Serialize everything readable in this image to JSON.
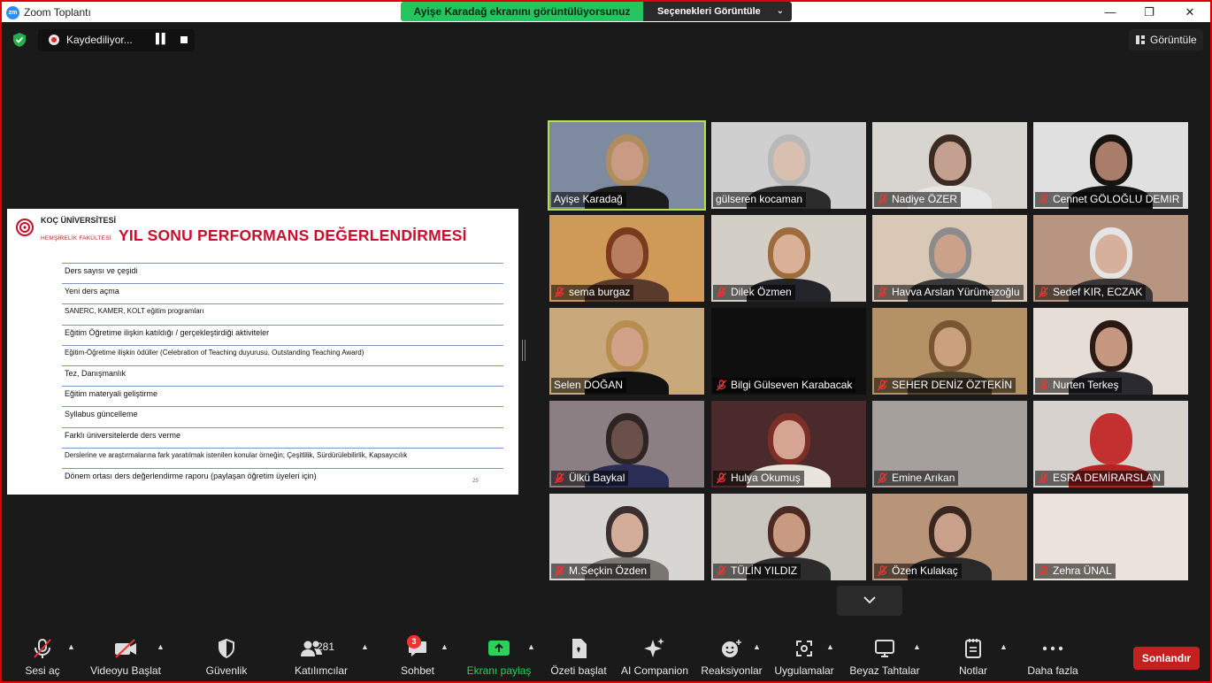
{
  "window": {
    "title": "Zoom Toplantı",
    "logo_text": "zm",
    "minimize": "—",
    "maximize": "❐",
    "close": "✕"
  },
  "share_banner": {
    "text": "Ayişe Karadağ ekranını görüntülüyorsunuz",
    "options_label": "Seçenekleri Görüntüle"
  },
  "recording": {
    "label": "Kaydediliyor..."
  },
  "view_button": {
    "label": "Görüntüle"
  },
  "slide": {
    "university": "KOÇ ÜNİVERSİTESİ",
    "faculty": "HEMŞİRELİK FAKÜLTESİ",
    "title": "YIL SONU PERFORMANS DEĞERLENDİRMESİ",
    "rows": [
      "Ders sayısı ve çeşidi",
      "Yeni ders açma",
      "SANERC, KAMER, KOLT eğitim programları",
      "Eğitim Öğretime ilişkin katıldığı / gerçekleştirdiği aktiviteler",
      "Eğitim-Öğretime ilişkin ödüller (Celebration of Teaching duyurusu, Outstanding Teaching Award)",
      "Tez, Danışmanlık",
      "Eğitim materyali geliştirme",
      "Syllabus güncelleme",
      "Farklı üniversitelerde ders verme",
      "Derslerine ve araştırmalarına fark yaratılmak istenilen konular örneğin; Çeşitlilik, Sürdürülebilirlik, Kapsayıcılık",
      "Dönem ortası ders değerlendirme raporu (paylaşan öğretim üyeleri için)"
    ],
    "page_number": "25"
  },
  "participants": [
    {
      "name": "Ayişe Karadağ",
      "muted": false,
      "active": true,
      "bg": "#7d8aa0",
      "skin": "#c99a84",
      "hair": "#b08d5c",
      "shirt": "#1c1c1c"
    },
    {
      "name": "gülseren kocaman",
      "muted": false,
      "active": false,
      "bg": "#cfcfcf",
      "skin": "#d9bfb0",
      "hair": "#b8b8b8",
      "shirt": "#2c2c2c"
    },
    {
      "name": "Nadiye ÖZER",
      "muted": true,
      "active": false,
      "bg": "#d8d4cf",
      "skin": "#c4a091",
      "hair": "#3b2b22",
      "shirt": "#e6e6e6"
    },
    {
      "name": "Cennet GÖLOĞLU DEMIR",
      "muted": true,
      "active": false,
      "bg": "#e0e0e0",
      "skin": "#a97d6a",
      "hair": "#1a1411",
      "shirt": "#151515"
    },
    {
      "name": "sema burgaz",
      "muted": true,
      "active": false,
      "bg": "#cf9a57",
      "skin": "#b97d60",
      "hair": "#7a3a1e",
      "shirt": "#5a3a2a"
    },
    {
      "name": "Dilek Özmen",
      "muted": true,
      "active": false,
      "bg": "#d3cfc6",
      "skin": "#dab097",
      "hair": "#9e6b3e",
      "shirt": "#24252a"
    },
    {
      "name": "Havva Arslan Yürümezoğlu",
      "muted": true,
      "active": false,
      "bg": "#d9c8b5",
      "skin": "#caa189",
      "hair": "#8c8c8c",
      "shirt": "#3a3a3a"
    },
    {
      "name": "Sedef KIR, ECZAK",
      "muted": true,
      "active": false,
      "bg": "#b79580",
      "skin": "#d7b09c",
      "hair": "#e5e5e5",
      "shirt": "#3b3737"
    },
    {
      "name": "Selen DOĞAN",
      "muted": false,
      "active": false,
      "bg": "#c9a87c",
      "skin": "#d1a188",
      "hair": "#b78e4f",
      "shirt": "#111111"
    },
    {
      "name": "Bilgi Gülseven Karabacak",
      "muted": true,
      "active": false,
      "bg": "#0f0f0f",
      "skin": "#0f0f0f",
      "hair": "#0f0f0f",
      "shirt": "#0f0f0f"
    },
    {
      "name": "SEHER DENİZ ÖZTEKİN",
      "muted": true,
      "active": false,
      "bg": "#b59266",
      "skin": "#caa07f",
      "hair": "#7a5532",
      "shirt": "#50442e"
    },
    {
      "name": "Nurten Terkeş",
      "muted": true,
      "active": false,
      "bg": "#e6ddd6",
      "skin": "#c69781",
      "hair": "#2b1a13",
      "shirt": "#2a2a30"
    },
    {
      "name": "Ülkü Baykal",
      "muted": true,
      "active": false,
      "bg": "#8c7f84",
      "skin": "#6b4f4a",
      "hair": "#2d2424",
      "shirt": "#2a2d55"
    },
    {
      "name": "Hulya Okumuş",
      "muted": true,
      "active": false,
      "bg": "#4a2a2a",
      "skin": "#d6a592",
      "hair": "#7a2e26",
      "shirt": "#e9e4dc"
    },
    {
      "name": "Emine Arıkan",
      "muted": true,
      "active": false,
      "bg": "#a6a09d",
      "skin": "#a6a09d",
      "hair": "#a6a09d",
      "shirt": "#a6a09d"
    },
    {
      "name": "ESRA DEMİRARSLAN",
      "muted": true,
      "active": false,
      "bg": "#d8d2cf",
      "skin": "#c23030",
      "hair": "#c23030",
      "shirt": "#b52323"
    },
    {
      "name": "M.Seçkin Özden",
      "muted": true,
      "active": false,
      "bg": "#d8d6d2",
      "skin": "#d4ad98",
      "hair": "#3a3030",
      "shirt": "#7a7672"
    },
    {
      "name": "TÜLİN YILDIZ",
      "muted": true,
      "active": false,
      "bg": "#c9c6bf",
      "skin": "#c89a82",
      "hair": "#4a2a22",
      "shirt": "#2c2c2c"
    },
    {
      "name": "Özen Kulakaç",
      "muted": true,
      "active": false,
      "bg": "#b89478",
      "skin": "#c9a08a",
      "hair": "#3a2720",
      "shirt": "#2a2a2a"
    },
    {
      "name": "Zehra ÜNAL",
      "muted": true,
      "active": false,
      "bg": "#ece4dc",
      "skin": "#ece4dc",
      "hair": "#ece4dc",
      "shirt": "#ece4dc"
    }
  ],
  "toolbar": {
    "audio": "Sesi aç",
    "video": "Videoyu Başlat",
    "security": "Güvenlik",
    "participants": "Katılımcılar",
    "participants_count": "281",
    "chat": "Sohbet",
    "chat_badge": "3",
    "share": "Ekranı paylaş",
    "summary": "Özeti başlat",
    "companion": "AI Companion",
    "reactions": "Reaksiyonlar",
    "apps": "Uygulamalar",
    "whiteboard": "Beyaz Tahtalar",
    "notes": "Notlar",
    "more": "Daha fazla",
    "end": "Sonlandır"
  },
  "colors": {
    "accent_green": "#23c55e",
    "active_speaker": "#b5e04a",
    "end_red": "#c42020",
    "slide_title": "#c8102e"
  }
}
